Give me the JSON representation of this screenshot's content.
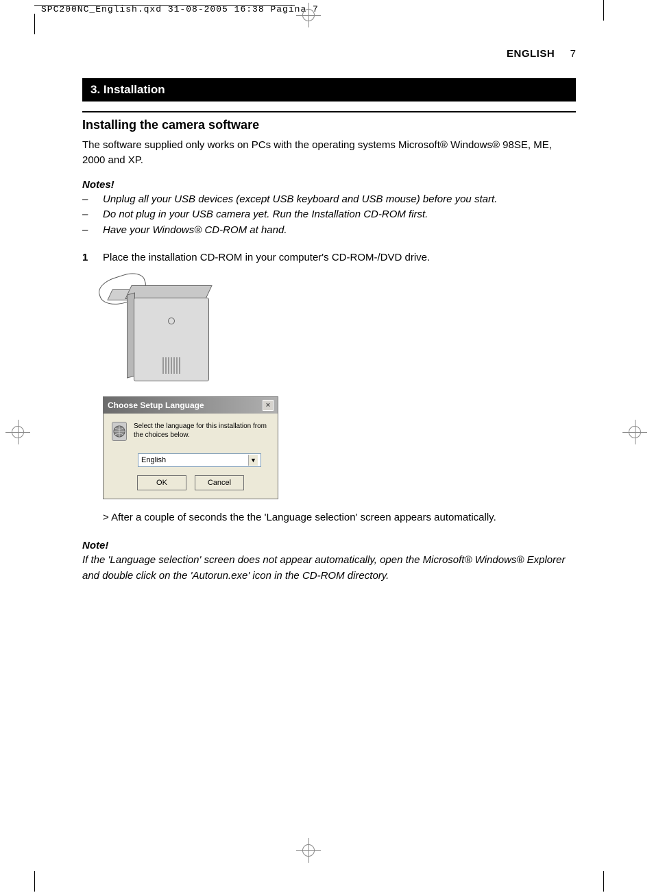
{
  "qxd_header": "SPC200NC_English.qxd  31-08-2005  16:38  Pagina 7",
  "header": {
    "language": "ENGLISH",
    "page": "7"
  },
  "section_title": "3. Installation",
  "subtitle": "Installing the camera software",
  "intro": "The software supplied only works on PCs with the operating systems Microsoft® Windows® 98SE, ME, 2000 and XP.",
  "notes_heading": "Notes!",
  "notes": [
    "Unplug all your USB devices (except USB keyboard and USB mouse) before you start.",
    "Do not plug in your USB camera yet. Run the Installation CD-ROM first.",
    "Have your Windows® CD-ROM at hand."
  ],
  "step1": {
    "num": "1",
    "text": "Place the installation CD-ROM in your computer's CD-ROM-/DVD drive."
  },
  "dialog": {
    "title": "Choose Setup Language",
    "close": "×",
    "message": "Select the language for this installation from the choices below.",
    "selected": "English",
    "ok": "OK",
    "cancel": "Cancel"
  },
  "after_dialog": "> After a couple of seconds the the 'Language selection' screen appears automatically.",
  "note2_heading": "Note!",
  "note2_body": "If the 'Language selection' screen does not appear automatically, open the Microsoft® Windows® Explorer and double click on the 'Autorun.exe' icon in the CD-ROM directory."
}
